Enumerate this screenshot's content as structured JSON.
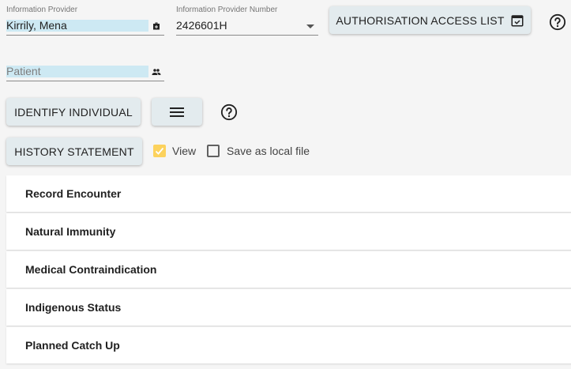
{
  "provider": {
    "label": "Information Provider",
    "value": "Kirrily, Mena",
    "icon": "medical-bag-icon"
  },
  "provider_number": {
    "label": "Information Provider Number",
    "value": "2426601H",
    "icon": "dropdown-arrow-icon"
  },
  "auth_button": {
    "label": "AUTHORISATION ACCESS LIST",
    "icon": "calendar-check-icon"
  },
  "patient": {
    "placeholder": "Patient",
    "icon": "people-icon"
  },
  "identify_button": {
    "label": "IDENTIFY INDIVIDUAL"
  },
  "menu_button": {
    "icon": "hamburger-menu-icon"
  },
  "history_button": {
    "label": "HISTORY STATEMENT"
  },
  "view_checkbox": {
    "label": "View",
    "checked": true
  },
  "save_checkbox": {
    "label": "Save as local file",
    "checked": false
  },
  "panels": [
    {
      "label": "Record Encounter"
    },
    {
      "label": "Natural Immunity"
    },
    {
      "label": "Medical Contraindication"
    },
    {
      "label": "Indigenous Status"
    },
    {
      "label": "Planned Catch Up"
    }
  ],
  "colors": {
    "field_highlight": "#cde9f3",
    "button_bg": "#e3ebee",
    "checkbox_checked": "#fcd25d"
  }
}
